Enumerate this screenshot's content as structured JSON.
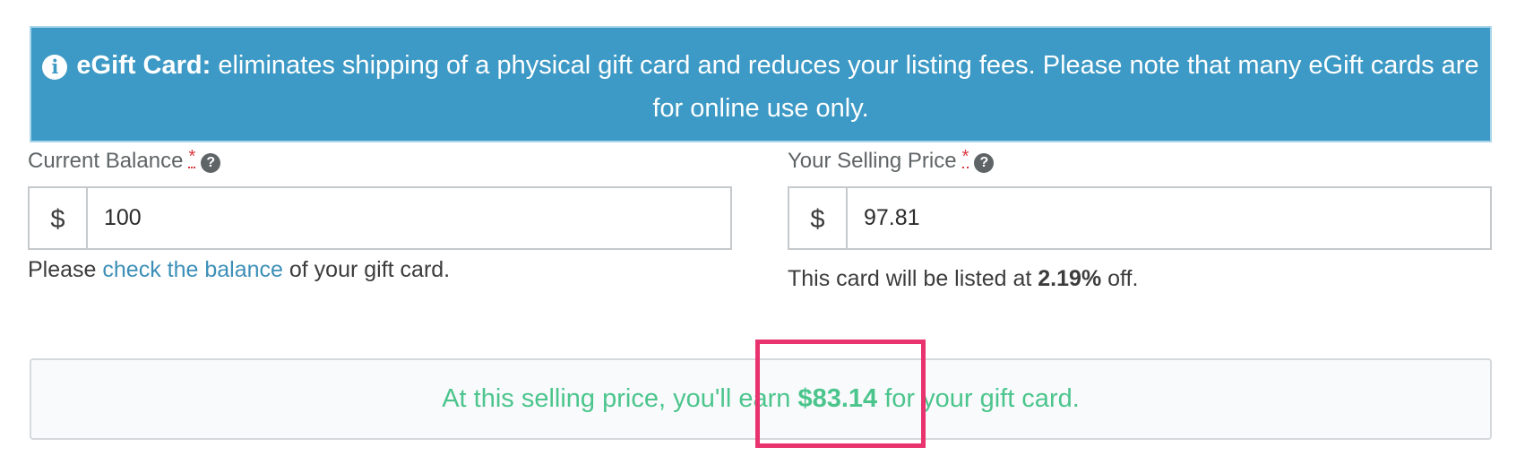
{
  "banner": {
    "icon": "info-icon",
    "icon_glyph": "i",
    "title": "eGift Card:",
    "message": " eliminates shipping of a physical gift card and reduces your listing fees. Please note that many eGift cards are for online use only."
  },
  "current_balance": {
    "label": "Current Balance",
    "required_mark": "*",
    "help_glyph": "?",
    "currency": "$",
    "value": "100",
    "help_prefix": "Please ",
    "help_link": "check the balance",
    "help_suffix": " of your gift card."
  },
  "selling_price": {
    "label": "Your Selling Price",
    "required_mark": "*",
    "help_glyph": "?",
    "currency": "$",
    "value": "97.81",
    "note_prefix": "This card will be listed at ",
    "discount": "2.19%",
    "note_suffix": " off."
  },
  "earnings": {
    "prefix": "At this selling price, you'll earn ",
    "amount": "$83.14",
    "suffix": " for your gift card."
  },
  "colors": {
    "banner_bg": "#3d99c5",
    "earn_text": "#4cc58d",
    "link": "#3d8fb8",
    "highlight": "#e8336f",
    "required": "#d9363e"
  }
}
